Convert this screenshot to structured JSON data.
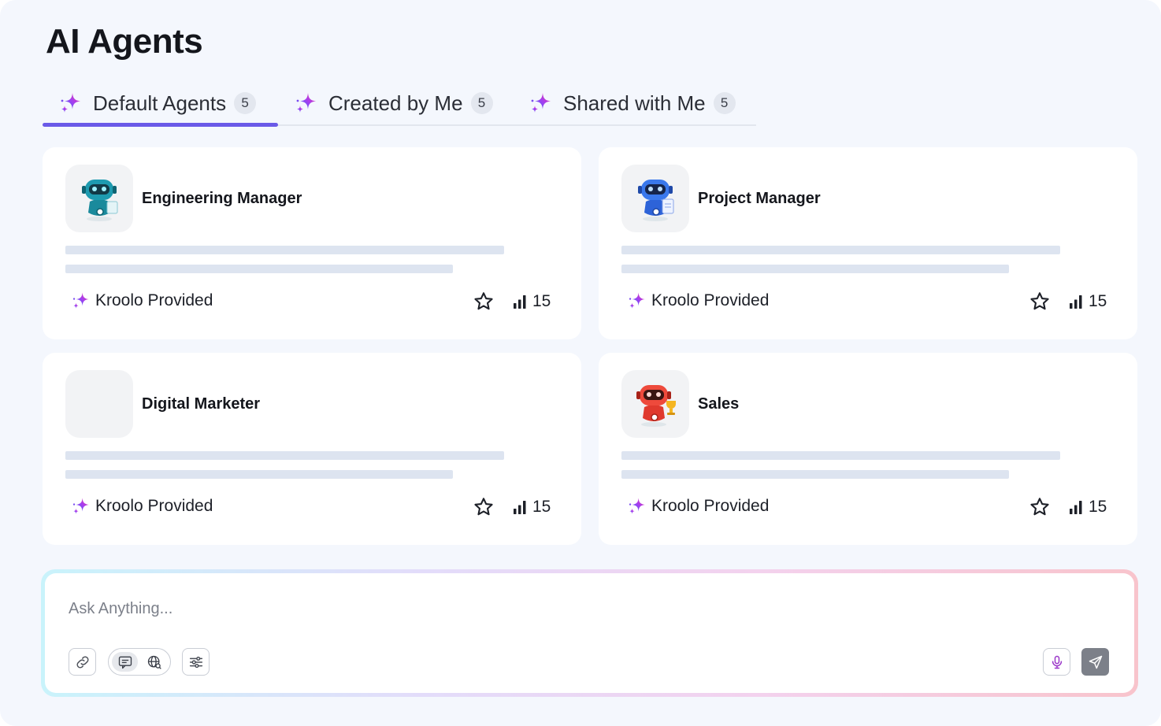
{
  "page": {
    "title": "AI Agents"
  },
  "tabs": [
    {
      "label": "Default Agents",
      "count": "5",
      "active": true
    },
    {
      "label": "Created by Me",
      "count": "5",
      "active": false
    },
    {
      "label": "Shared with Me",
      "count": "5",
      "active": false
    }
  ],
  "cards": [
    {
      "name": "Engineering Manager",
      "provider": "Kroolo Provided",
      "stat": "15",
      "avatar": "teal-robot-with-document",
      "avatar_color": "#1a8a9c"
    },
    {
      "name": "Project Manager",
      "provider": "Kroolo Provided",
      "stat": "15",
      "avatar": "blue-robot-with-clipboard",
      "avatar_color": "#2d63d8"
    },
    {
      "name": "Digital Marketer",
      "provider": "Kroolo Provided",
      "stat": "15",
      "avatar": "empty",
      "avatar_color": ""
    },
    {
      "name": "Sales",
      "provider": "Kroolo Provided",
      "stat": "15",
      "avatar": "red-robot-with-trophy",
      "avatar_color": "#e03a2e"
    }
  ],
  "ask": {
    "placeholder": "Ask Anything...",
    "tools": [
      "link-icon",
      "chat-icon",
      "web-search-icon",
      "sliders-icon",
      "microphone-icon",
      "send-icon"
    ]
  },
  "colors": {
    "accent": "#6a5ae8",
    "background": "#f4f7fd",
    "spark_gradient": [
      "#3b6cf6",
      "#a63ef0",
      "#f0369a"
    ]
  }
}
